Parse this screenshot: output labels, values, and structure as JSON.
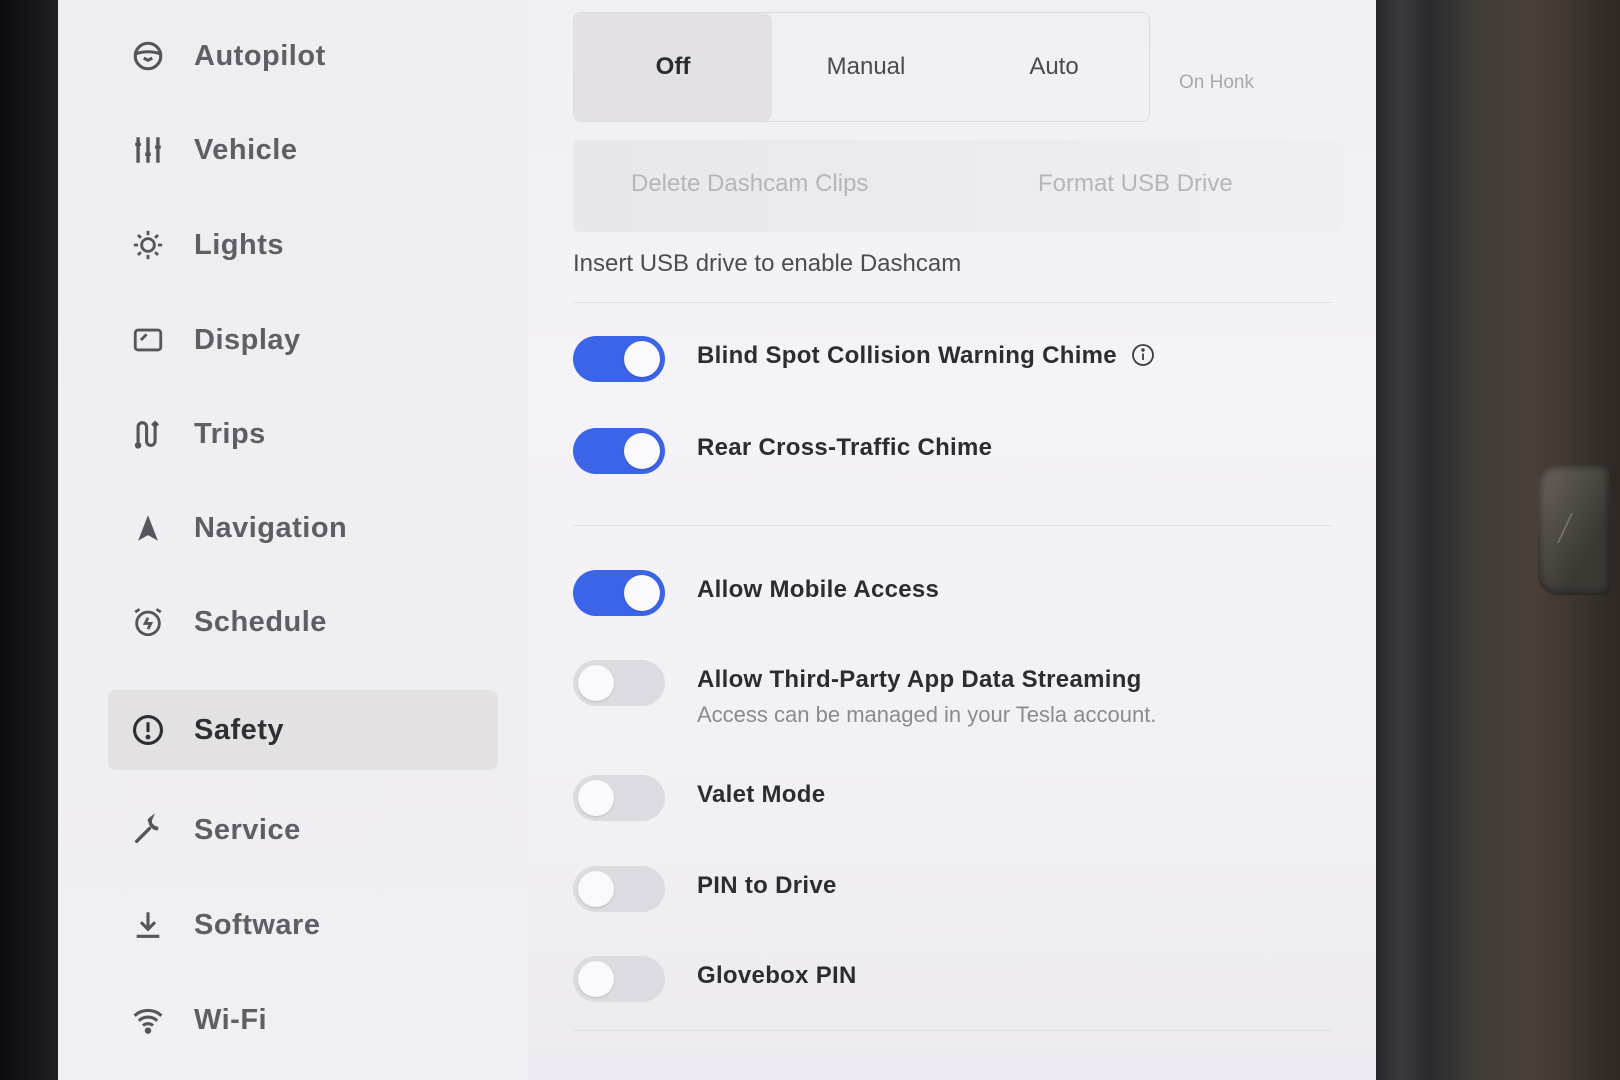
{
  "sidebar": {
    "items": [
      {
        "label": "Autopilot",
        "icon": "steering-wheel-icon"
      },
      {
        "label": "Vehicle",
        "icon": "sliders-icon"
      },
      {
        "label": "Lights",
        "icon": "sun-icon"
      },
      {
        "label": "Display",
        "icon": "display-icon"
      },
      {
        "label": "Trips",
        "icon": "trips-icon"
      },
      {
        "label": "Navigation",
        "icon": "navigation-arrow-icon"
      },
      {
        "label": "Schedule",
        "icon": "alarm-clock-icon"
      },
      {
        "label": "Safety",
        "icon": "exclamation-circle-icon",
        "active": true
      },
      {
        "label": "Service",
        "icon": "wrench-icon"
      },
      {
        "label": "Software",
        "icon": "download-icon"
      },
      {
        "label": "Wi-Fi",
        "icon": "wifi-icon"
      }
    ]
  },
  "dashcam": {
    "modes": [
      "Off",
      "Manual",
      "Auto"
    ],
    "selected": "Off",
    "on_honk_label": "On Honk",
    "delete_clips_label": "Delete Dashcam Clips",
    "format_usb_label": "Format USB Drive",
    "usb_note": "Insert USB drive to enable Dashcam"
  },
  "toggles": [
    {
      "label": "Blind Spot Collision Warning Chime",
      "on": true,
      "info": true
    },
    {
      "label": "Rear Cross-Traffic Chime",
      "on": true
    },
    {
      "label": "Allow Mobile Access",
      "on": true
    },
    {
      "label": "Allow Third-Party App Data Streaming",
      "on": false,
      "sublabel": "Access can be managed in your Tesla account."
    },
    {
      "label": "Valet Mode",
      "on": false
    },
    {
      "label": "PIN to Drive",
      "on": false
    },
    {
      "label": "Glovebox PIN",
      "on": false
    }
  ],
  "colors": {
    "toggle_on": "#3b64e8",
    "toggle_off": "#dcdbe1",
    "active_nav_bg": "#e4e1e2"
  }
}
